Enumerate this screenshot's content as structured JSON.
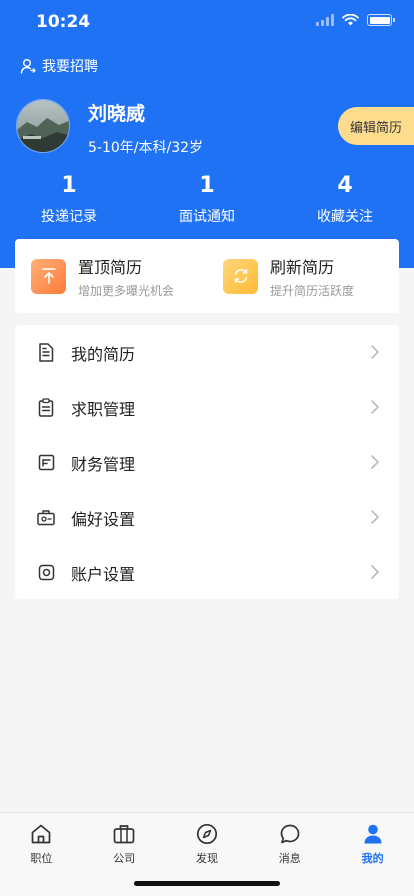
{
  "status_bar": {
    "time": "10:24"
  },
  "header": {
    "recruit_label": "我要招聘",
    "profile": {
      "name": "刘晓威",
      "info": "5-10年/本科/32岁"
    },
    "edit_resume_label": "编辑简历",
    "stats": [
      {
        "value": "1",
        "label": "投递记录"
      },
      {
        "value": "1",
        "label": "面试通知"
      },
      {
        "value": "4",
        "label": "收藏关注"
      }
    ]
  },
  "promos": [
    {
      "title": "置顶简历",
      "desc": "增加更多曝光机会",
      "icon": "arrow-up-icon"
    },
    {
      "title": "刷新简历",
      "desc": "提升简历活跃度",
      "icon": "refresh-icon"
    }
  ],
  "menu": [
    {
      "label": "我的简历",
      "icon": "document-icon"
    },
    {
      "label": "求职管理",
      "icon": "clipboard-icon"
    },
    {
      "label": "财务管理",
      "icon": "wallet-icon"
    },
    {
      "label": "偏好设置",
      "icon": "briefcase-settings-icon"
    },
    {
      "label": "账户设置",
      "icon": "account-icon"
    }
  ],
  "tabbar": [
    {
      "label": "职位",
      "icon": "home-icon",
      "active": false
    },
    {
      "label": "公司",
      "icon": "briefcase-icon",
      "active": false
    },
    {
      "label": "发现",
      "icon": "compass-icon",
      "active": false
    },
    {
      "label": "消息",
      "icon": "chat-icon",
      "active": false
    },
    {
      "label": "我的",
      "icon": "user-icon",
      "active": true
    }
  ],
  "colors": {
    "primary": "#2072f5",
    "edit_button": "#fddc8e",
    "promo_orange": "#ff8a48",
    "promo_yellow": "#ffc54d"
  }
}
